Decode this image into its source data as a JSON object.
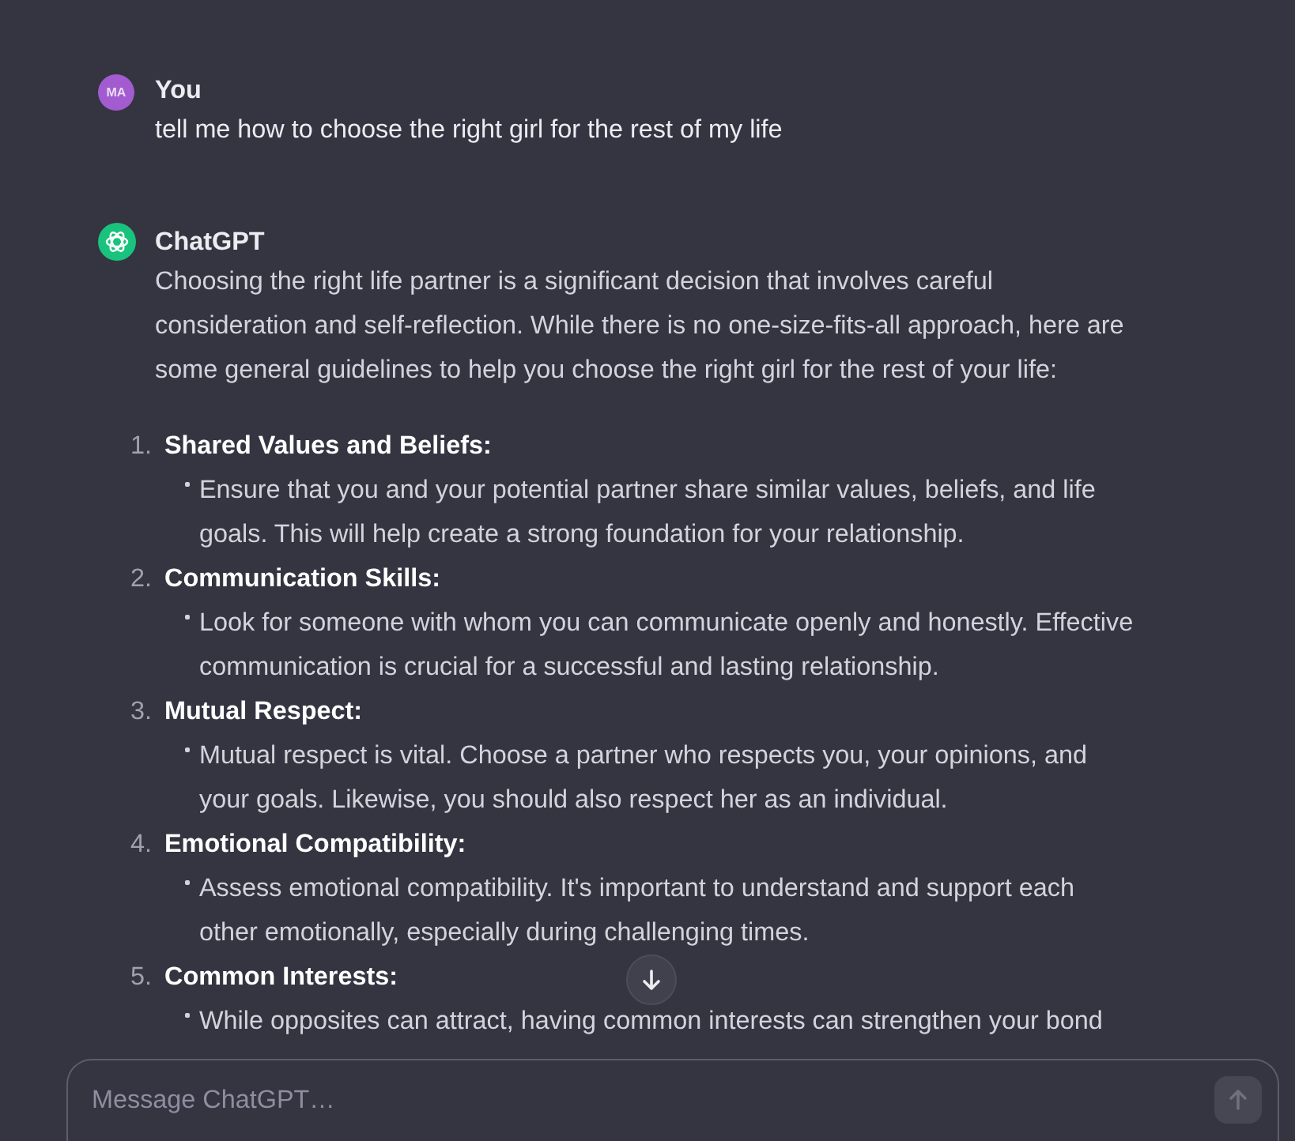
{
  "messages": [
    {
      "kind": "user",
      "author": "You",
      "avatar": "MA",
      "text": "tell me how to choose the right girl for the rest of my life"
    },
    {
      "kind": "assistant",
      "author": "ChatGPT",
      "text": "Choosing the right life partner is a significant decision that involves careful consideration and self-reflection. While there is no one-size-fits-all approach, here are some general guidelines to help you choose the right girl for the rest of your life:",
      "list": [
        {
          "number": "1.",
          "title": "Shared Values and Beliefs:",
          "points": [
            "Ensure that you and your potential partner share similar values, beliefs, and life goals. This will help create a strong foundation for your relationship."
          ]
        },
        {
          "number": "2.",
          "title": "Communication Skills:",
          "points": [
            "Look for someone with whom you can communicate openly and honestly. Effective communication is crucial for a successful and lasting relationship."
          ]
        },
        {
          "number": "3.",
          "title": "Mutual Respect:",
          "points": [
            "Mutual respect is vital. Choose a partner who respects you, your opinions, and your goals. Likewise, you should also respect her as an individual."
          ]
        },
        {
          "number": "4.",
          "title": "Emotional Compatibility:",
          "points": [
            "Assess emotional compatibility. It's important to understand and support each other emotionally, especially during challenging times."
          ]
        },
        {
          "number": "5.",
          "title": "Common Interests:",
          "points": [
            "While opposites can attract, having common interests can strengthen your bond"
          ]
        }
      ]
    }
  ],
  "composer": {
    "placeholder": "Message ChatGPT…",
    "send_disabled": true
  }
}
